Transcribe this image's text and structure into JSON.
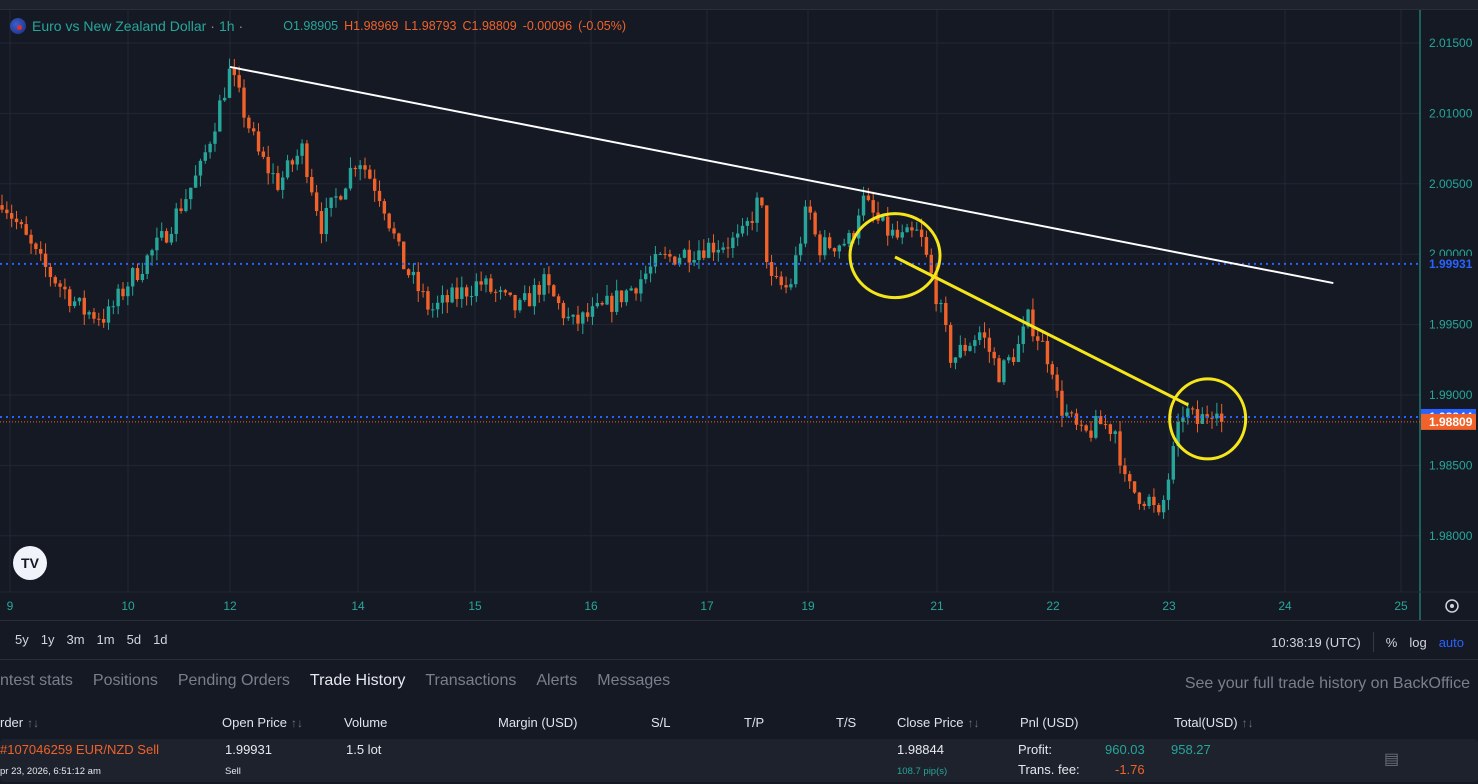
{
  "header": {
    "symbol": "Euro vs New Zealand Dollar",
    "interval": "1h",
    "ohlc": {
      "open": "O1.98905",
      "high": "H1.98969",
      "low": "L1.98793",
      "close": "C1.98809",
      "change": "-0.00096",
      "change_pct": "(-0.05%)"
    }
  },
  "colors": {
    "background": "#151924",
    "up": "#26a69a",
    "down": "#f0622a",
    "grid": "#232733",
    "axis_text": "#26a69a",
    "trendline": "#ffffff",
    "annotation": "#f5e61a",
    "bid_line": "#2962ff",
    "ask_line": "#f0622a"
  },
  "chart_data": {
    "type": "candlestick",
    "interval": "1h",
    "y_ticks": [
      "2.01500",
      "2.01000",
      "2.00500",
      "2.00000",
      "1.99500",
      "1.99000",
      "1.98500",
      "1.98000"
    ],
    "y_range": [
      1.9775,
      2.0175
    ],
    "x_ticks": [
      "9",
      "10",
      "12",
      "14",
      "15",
      "16",
      "17",
      "19",
      "21",
      "22",
      "23",
      "24",
      "25"
    ],
    "grid": true,
    "price_path": [
      [
        "09 00:00",
        2.003
      ],
      [
        "09 06:00",
        1.9995
      ],
      [
        "09 15:00",
        1.996
      ],
      [
        "09 20:00",
        1.9955
      ],
      [
        "10 00:00",
        1.998
      ],
      [
        "10 07:00",
        2.001
      ],
      [
        "10 15:00",
        2.006
      ],
      [
        "12 00:00",
        2.013
      ],
      [
        "12 06:00",
        2.007
      ],
      [
        "12 10:00",
        2.005
      ],
      [
        "12 15:00",
        2.0075
      ],
      [
        "12 19:00",
        2.002
      ],
      [
        "14 00:00",
        2.007
      ],
      [
        "14 05:00",
        2.004
      ],
      [
        "14 09:00",
        1.9995
      ],
      [
        "14 15:00",
        1.996
      ],
      [
        "15 01:00",
        1.998
      ],
      [
        "15 09:00",
        1.996
      ],
      [
        "15 14:00",
        1.998
      ],
      [
        "15 20:00",
        1.995
      ],
      [
        "16 02:00",
        1.996
      ],
      [
        "16 08:00",
        1.9975
      ],
      [
        "16 14:00",
        1.9995
      ],
      [
        "16 23:00",
        2.0005
      ],
      [
        "17 07:00",
        2.001
      ],
      [
        "17 11:00",
        2.004
      ],
      [
        "17 13:00",
        1.998
      ],
      [
        "17 17:00",
        1.9975
      ],
      [
        "19 00:00",
        2.0035
      ],
      [
        "19 02:00",
        2.0005
      ],
      [
        "19 09:00",
        2.001
      ],
      [
        "19 11:00",
        2.004
      ],
      [
        "19 15:00",
        2.002
      ],
      [
        "19 19:00",
        2.001
      ],
      [
        "19 23:00",
        2.0015
      ],
      [
        "21 00:00",
        1.997
      ],
      [
        "21 03:00",
        1.9925
      ],
      [
        "21 09:00",
        1.9945
      ],
      [
        "21 13:00",
        1.9915
      ],
      [
        "21 17:00",
        1.9935
      ],
      [
        "21 19:00",
        1.9955
      ],
      [
        "22 00:00",
        1.992
      ],
      [
        "22 01:00",
        1.9895
      ],
      [
        "22 06:00",
        1.987
      ],
      [
        "22 10:00",
        1.988
      ],
      [
        "22 13:00",
        1.9875
      ],
      [
        "22 15:00",
        1.9835
      ],
      [
        "22 20:00",
        1.9825
      ],
      [
        "22 22:00",
        1.981
      ],
      [
        "23 01:00",
        1.986
      ],
      [
        "23 03:00",
        1.989
      ],
      [
        "23 06:00",
        1.988
      ],
      [
        "23 10:00",
        1.9895
      ],
      [
        "23 11:00",
        1.98809
      ]
    ],
    "price_lines": [
      {
        "label": "1.99931",
        "value": 1.99931,
        "color": "#2962ff"
      },
      {
        "label": "1.98844",
        "value": 1.98844,
        "color": "#2962ff",
        "badge": true
      },
      {
        "label": "1.98809",
        "value": 1.98809,
        "color": "#f0622a",
        "badge": true
      }
    ],
    "drawings": {
      "trendline": {
        "from": [
          "12 00:00",
          2.0133
        ],
        "to": [
          "24 10:00",
          1.99795
        ]
      },
      "yellow_line": {
        "from": [
          "19 18:00",
          1.9998
        ],
        "to": [
          "23 04:00",
          1.98929
        ]
      },
      "circles": [
        {
          "center": [
            "19 18:00",
            1.9999
          ]
        },
        {
          "center": [
            "23 08:00",
            1.9883
          ]
        }
      ]
    }
  },
  "toolbar": {
    "ranges": [
      "5y",
      "1y",
      "3m",
      "1m",
      "5d",
      "1d"
    ],
    "time": "10:38:19 (UTC)",
    "percent": "%",
    "log": "log",
    "auto": "auto"
  },
  "tabs": [
    "ntest stats",
    "Positions",
    "Pending Orders",
    "Trade History",
    "Transactions",
    "Alerts",
    "Messages"
  ],
  "active_tab": "Trade History",
  "backoffice_link": "See your full trade history on BackOffice",
  "table": {
    "columns": [
      "rder",
      "Open Price",
      "Volume",
      "Margin (USD)",
      "S/L",
      "T/P",
      "T/S",
      "Close Price",
      "Pnl (USD)",
      "Total(USD)"
    ],
    "sort_icon": "↑↓",
    "rows": [
      {
        "order": "#107046259 EUR/NZD Sell",
        "date": "pr 23, 2026, 6:51:12 am",
        "open_price": "1.99931",
        "side": "Sell",
        "volume": "1.5 lot",
        "close_price": "1.98844",
        "pips": "108.7 pip(s)",
        "profit_label": "Profit:",
        "profit": "960.03",
        "fee_label": "Trans. fee:",
        "fee": "-1.76",
        "total": "958.27"
      }
    ]
  }
}
